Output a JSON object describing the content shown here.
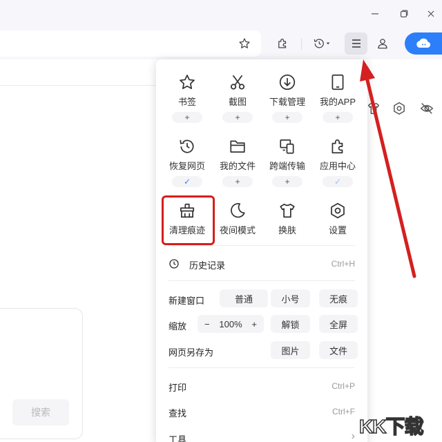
{
  "window": {
    "controls": [
      "minimize-icon",
      "restore-icon",
      "close-icon"
    ]
  },
  "menu": {
    "tiles": [
      {
        "label": "书签",
        "badge": "+",
        "icon": "star-icon"
      },
      {
        "label": "截图",
        "badge": "+",
        "icon": "scissors-icon"
      },
      {
        "label": "下载管理",
        "badge": "+",
        "icon": "download-icon"
      },
      {
        "label": "我的APP",
        "badge": "+",
        "icon": "app-icon"
      },
      {
        "label": "恢复网页",
        "badge": "✓",
        "icon": "restore-page-icon"
      },
      {
        "label": "我的文件",
        "badge": "+",
        "icon": "folder-icon"
      },
      {
        "label": "跨端传输",
        "badge": "+",
        "icon": "transfer-icon"
      },
      {
        "label": "应用中心",
        "badge": "✓",
        "icon": "puzzle-icon"
      },
      {
        "label": "清理痕迹",
        "icon": "broom-icon"
      },
      {
        "label": "夜间模式",
        "icon": "moon-icon"
      },
      {
        "label": "换肤",
        "icon": "tshirt-icon"
      },
      {
        "label": "设置",
        "icon": "settings-icon"
      }
    ],
    "history": {
      "label": "历史记录",
      "shortcut": "Ctrl+H"
    },
    "new_window": {
      "label": "新建窗口",
      "normal": "普通",
      "small": "小号",
      "incognito": "无痕"
    },
    "zoom": {
      "label": "缩放",
      "minus": "−",
      "value": "100%",
      "plus": "+",
      "unlock": "解锁",
      "fullscreen": "全屏"
    },
    "save_as": {
      "label": "网页另存为",
      "image": "图片",
      "file": "文件"
    },
    "print": {
      "label": "打印",
      "shortcut": "Ctrl+P"
    },
    "find": {
      "label": "查找",
      "shortcut": "Ctrl+F"
    },
    "tools": {
      "label": "工具",
      "chevron": "›"
    }
  },
  "page": {
    "search_button": "搜索"
  },
  "watermark": "KK下载",
  "colors": {
    "accent": "#2d7ff9",
    "highlight": "#d71c1c",
    "arrow": "#d42020",
    "check": "#3d7ef7"
  }
}
